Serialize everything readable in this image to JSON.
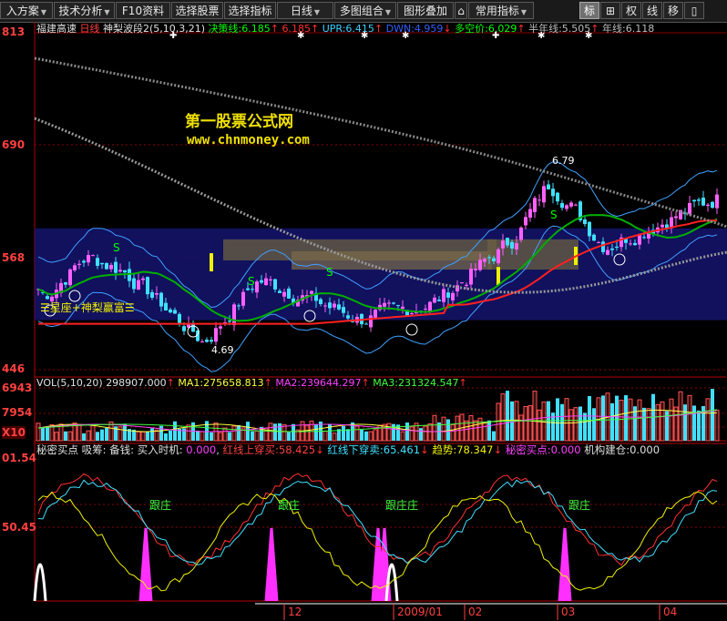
{
  "toolbar": {
    "items": [
      {
        "label": "入方案",
        "dropdown": true
      },
      {
        "label": "技术分析",
        "dropdown": true
      },
      {
        "label": "F10资料",
        "dropdown": false
      },
      {
        "label": "选择股票",
        "dropdown": false
      },
      {
        "label": "选择指标",
        "dropdown": false
      },
      {
        "label": "日线",
        "dropdown": true
      },
      {
        "label": "多图组合",
        "dropdown": true
      },
      {
        "label": "图形叠加",
        "dropdown": false
      },
      {
        "label": "常用指标",
        "dropdown": true
      }
    ],
    "right_buttons": [
      "标",
      "⊞",
      "权",
      "线",
      "移",
      "▯"
    ],
    "active_right": "标"
  },
  "main": {
    "stock_name": "福建高速",
    "period": "日线",
    "indicator_name": "神梨波段2(5,10,3,21)",
    "legend": [
      {
        "label": "决策线:",
        "value": "6.185",
        "color": "#00ff00"
      },
      {
        "label": "",
        "value": "6.185",
        "color": "#ff3030"
      },
      {
        "label": "UPR:",
        "value": "6.415",
        "color": "#3fd0ff"
      },
      {
        "label": "DWN:",
        "value": "4.959",
        "color": "#3060ff"
      },
      {
        "label": "多空价:",
        "value": "6.029",
        "color": "#00ff00"
      },
      {
        "label": "半年线:",
        "value": "5.505",
        "color": "#bbbbbb"
      },
      {
        "label": "年线:",
        "value": "6.118",
        "color": "#bbbbbb"
      }
    ],
    "y_labels": [
      "813",
      "690",
      "568",
      "446"
    ],
    "watermark_title": "第一股票公式网",
    "watermark_url": "www.chnmoney.com",
    "high_label": "6.79",
    "low_label": "4.69",
    "caption": "☰星座+神梨赢富☰",
    "signal_s": "S",
    "signal_zheng": "正"
  },
  "vol": {
    "title": "VOL(5,10,20)",
    "value": "298907.000",
    "ma1": "275658.813",
    "ma2": "239644.297",
    "ma3": "231324.547",
    "y_labels": [
      "6943",
      "7954",
      "X10"
    ]
  },
  "bottom": {
    "title": "秘密买点 吸筹: 备钱: 买入时机:",
    "buy_value": "0.000",
    "red_up_label": "红线上穿买:",
    "red_up_value": "58.425",
    "red_down_label": "红线下穿卖:",
    "red_down_value": "65.461",
    "trend_label": "趋势:",
    "trend_value": "78.347",
    "secret_label": "秘密买点:",
    "secret_value": "0.000",
    "inst_label": "机构建仓:",
    "inst_value": "0.000",
    "y_labels": [
      "01.54",
      "50.45"
    ],
    "tag_genzhuang": "跟庄",
    "tag_genzhuang2": "跟庄庄"
  },
  "date_axis": [
    "12",
    "2009/01",
    "02",
    "03",
    "04"
  ],
  "colors": {
    "up": "#ff60ff",
    "down": "#40e0ff",
    "zone": "#14146e",
    "grid": "#8b0000",
    "red": "#ff2020",
    "yellow": "#f0f000"
  }
}
